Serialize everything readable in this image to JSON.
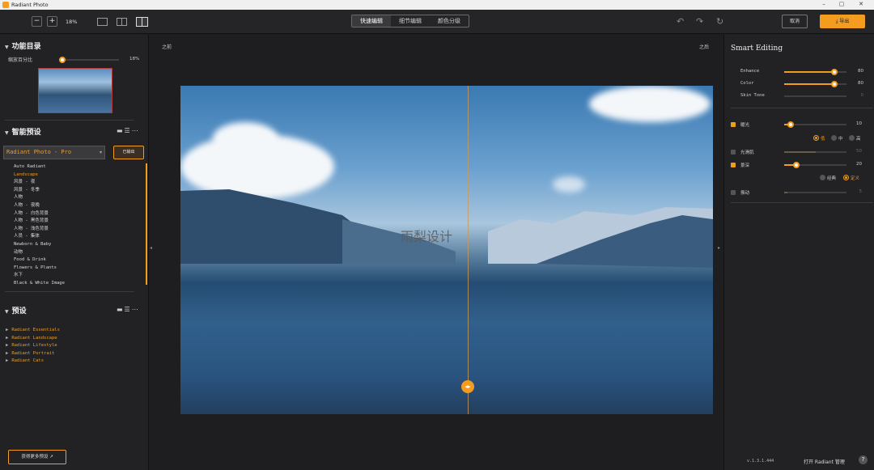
{
  "window": {
    "title": "Radiant Photo",
    "controls": [
      "–",
      "▢",
      "✕"
    ]
  },
  "toolbar": {
    "zoom_out": "−",
    "zoom_in": "+",
    "zoom_level": "18%",
    "tabs": [
      {
        "label": "快速编辑",
        "active": true
      },
      {
        "label": "细节编辑",
        "active": false
      },
      {
        "label": "颜色分级",
        "active": false
      }
    ],
    "cancel_label": "取消",
    "export_label": "⤓ 导出",
    "accent_color": "#f39c1f"
  },
  "left": {
    "catalog_title": "功能目录",
    "zoom_percent_label": "缩放百分比",
    "zoom_percent_value": "18%",
    "zoom_percent_level": 0.18,
    "smart_presets_title": "智能预设",
    "preset_select_value": "Radiant Photo - Pro",
    "export_button": "已输出",
    "preset_items": [
      {
        "label": "Auto Radiant",
        "selected": false
      },
      {
        "label": "Landscape",
        "selected": true
      },
      {
        "label": "风景 - 夜",
        "selected": false
      },
      {
        "label": "风景 - 冬季",
        "selected": false
      },
      {
        "label": "人物",
        "selected": false
      },
      {
        "label": "人物 - 夜晚",
        "selected": false
      },
      {
        "label": "人物 - 白色背景",
        "selected": false
      },
      {
        "label": "人物 - 黑色背景",
        "selected": false
      },
      {
        "label": "人物 - 浅色背景",
        "selected": false
      },
      {
        "label": "人员 - 集体",
        "selected": false
      },
      {
        "label": "Newborn & Baby",
        "selected": false
      },
      {
        "label": "动物",
        "selected": false
      },
      {
        "label": "Food & Drink",
        "selected": false
      },
      {
        "label": "Flowers & Plants",
        "selected": false
      },
      {
        "label": "水下",
        "selected": false
      },
      {
        "label": "Black & White Image",
        "selected": false
      }
    ],
    "presets_title": "预设",
    "preset_groups": [
      "Radiant Essentials",
      "Radiant Landscape",
      "Radiant Lifestyle",
      "Radiant Portrait",
      "Radiant Cats"
    ],
    "more_presets_label": "获得更多预设"
  },
  "center": {
    "before_label": "之前",
    "after_label": "之后",
    "watermark": "雨梨设计"
  },
  "right": {
    "title": "Smart Editing",
    "sliders": [
      {
        "label": "Enhance",
        "value": "80",
        "level": 0.8
      },
      {
        "label": "Color",
        "value": "80",
        "level": 0.8
      },
      {
        "label": "Skin Tone",
        "value": "0",
        "level": 0.0
      }
    ],
    "options": [
      {
        "label": "暖光",
        "checked": true,
        "value": "10",
        "level": 0.1
      },
      {
        "label": "光滑肌",
        "checked": false,
        "value": "50",
        "level": 0.5
      },
      {
        "label": "景深",
        "checked": true,
        "value": "20",
        "level": 0.2
      },
      {
        "label": "振动",
        "checked": false,
        "value": "5",
        "level": 0.05
      }
    ],
    "warm_radio": [
      {
        "label": "低",
        "on": true
      },
      {
        "label": "中",
        "on": false
      },
      {
        "label": "高",
        "on": false
      }
    ],
    "depth_radio": [
      {
        "label": "经典",
        "on": false
      },
      {
        "label": "定义",
        "on": true
      }
    ],
    "version": "v.1.3.1.444",
    "open_manager": "打开 Radiant 管理",
    "help": "?"
  }
}
